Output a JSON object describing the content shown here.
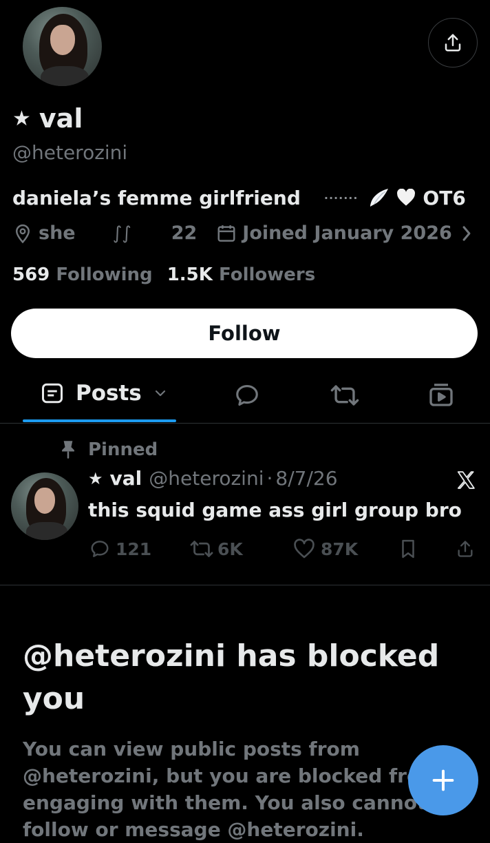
{
  "profile": {
    "name": "val",
    "name_star": "★",
    "handle": "@heterozini",
    "bio_text": "daniela’s femme girlfriend",
    "bio_dots": "·······",
    "bio_tag": "OT6",
    "location": "she",
    "location_glyph": "∫∫",
    "website": "22",
    "joined": "Joined January 2026",
    "following_count": "569",
    "following_label": "Following",
    "followers_count": "1.5K",
    "followers_label": "Followers"
  },
  "follow_button": {
    "label": "Follow"
  },
  "tabs": {
    "posts_label": "Posts"
  },
  "pinned_tweet": {
    "pinned_label": "Pinned",
    "author_star": "★",
    "author_name": "val",
    "author_handle": "@heterozini",
    "separator": "·",
    "date": "8/7/26",
    "text": "this squid game ass girl group bro",
    "replies": "121",
    "retweets": "6K",
    "likes": "87K"
  },
  "blocked": {
    "title": "@heterozini has blocked you",
    "body": "You can view public posts from @heterozini, but you are blocked from engaging with them. You also cannot follow or message @heterozini."
  },
  "colors": {
    "background": "#000000",
    "text_primary": "#e7e9ea",
    "text_secondary": "#71767b",
    "accent": "#1d9bf0",
    "fab": "#4a99e9"
  },
  "icons": [
    "share-icon",
    "location-icon",
    "calendar-icon",
    "chevron-right-icon",
    "posts-icon",
    "chevron-down-icon",
    "replies-icon",
    "retweet-icon",
    "media-icon",
    "pin-icon",
    "x-logo-icon",
    "reply-icon",
    "like-icon",
    "bookmark-icon",
    "plus-icon"
  ]
}
